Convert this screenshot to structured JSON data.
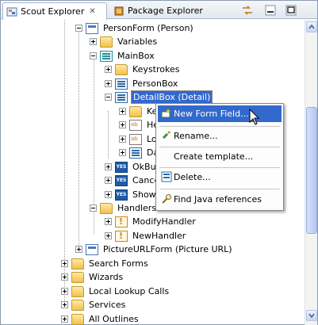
{
  "tabs": {
    "active": {
      "label": "Scout Explorer",
      "close": "✕",
      "icon": "scout-explorer-icon"
    },
    "inactive": {
      "label": "Package Explorer",
      "icon": "package-explorer-icon"
    }
  },
  "toolbar": {
    "sync_icon": "link-with-editor-icon",
    "minimize_icon": "minimize-icon",
    "maximize_icon": "maximize-icon"
  },
  "tree": {
    "personform": "PersonForm (Person)",
    "variables": "Variables",
    "mainbox": "MainBox",
    "keystrokes": "Keystrokes",
    "personbox": "PersonBox",
    "detailbox": "DetailBox (Detail)",
    "ke": "Ke",
    "he": "He",
    "lo": "Lo",
    "da": "Da",
    "okbutton": "OkBut",
    "cancel": "Cance",
    "showl": "Showl",
    "handlers": "Handlers",
    "modifyhandler": "ModifyHandler",
    "newhandler": "NewHandler",
    "pictureurlform": "PictureURLForm (Picture URL)",
    "searchforms": "Search Forms",
    "wizards": "Wizards",
    "locallookup": "Local Lookup Calls",
    "services": "Services",
    "alloutlines": "All Outlines"
  },
  "menu": {
    "new_form_field": "New Form Field...",
    "rename": "Rename...",
    "create_template": "Create template...",
    "delete": "Delete...",
    "find_java_refs": "Find Java references"
  },
  "colors": {
    "selection": "#3369cc",
    "accent": "#2c6aa5"
  }
}
